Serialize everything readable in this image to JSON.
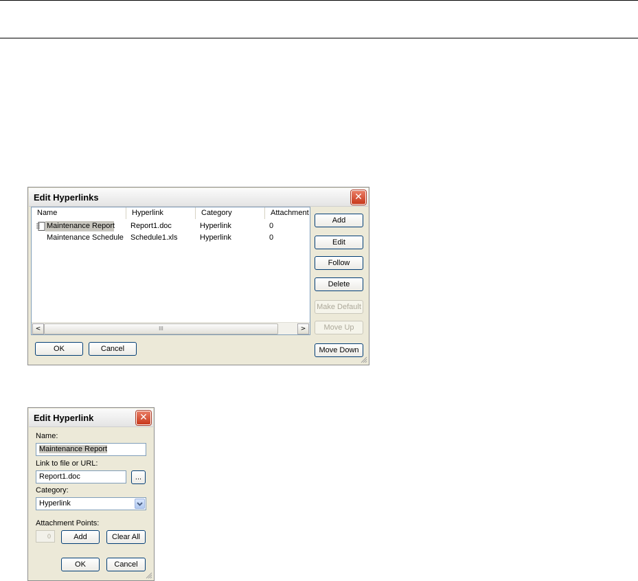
{
  "edit_hyperlinks": {
    "title": "Edit Hyperlinks",
    "close_glyph": "✕",
    "columns": [
      "Name",
      "Hyperlink",
      "Category",
      "Attachment"
    ],
    "rows": [
      {
        "name": "Maintenance Report",
        "hyperlink": "Report1.doc",
        "category": "Hyperlink",
        "attachment": "0",
        "selected": true
      },
      {
        "name": "Maintenance Schedule",
        "hyperlink": "Schedule1.xls",
        "category": "Hyperlink",
        "attachment": "0",
        "selected": false
      }
    ],
    "scroll_left": "<",
    "scroll_right": ">",
    "thumb_glyph": "III",
    "buttons": {
      "add": "Add",
      "edit": "Edit",
      "follow": "Follow",
      "delete": "Delete",
      "make_default": "Make Default",
      "move_up": "Move Up",
      "move_down": "Move Down",
      "ok": "OK",
      "cancel": "Cancel"
    }
  },
  "edit_hyperlink": {
    "title": "Edit Hyperlink",
    "close_glyph": "✕",
    "name_label": "Name:",
    "name_value": "Maintenance Report",
    "link_label": "Link to file or URL:",
    "link_value": "Report1.doc",
    "browse_label": "...",
    "category_label": "Category:",
    "category_value": "Hyperlink",
    "attachment_label": "Attachment Points:",
    "attachment_count": "0",
    "add_label": "Add",
    "clear_label": "Clear All",
    "ok_label": "OK",
    "cancel_label": "Cancel"
  },
  "colors": {
    "selection": "#c8c6be",
    "accent": "#003c74",
    "close": "#c8381b"
  }
}
